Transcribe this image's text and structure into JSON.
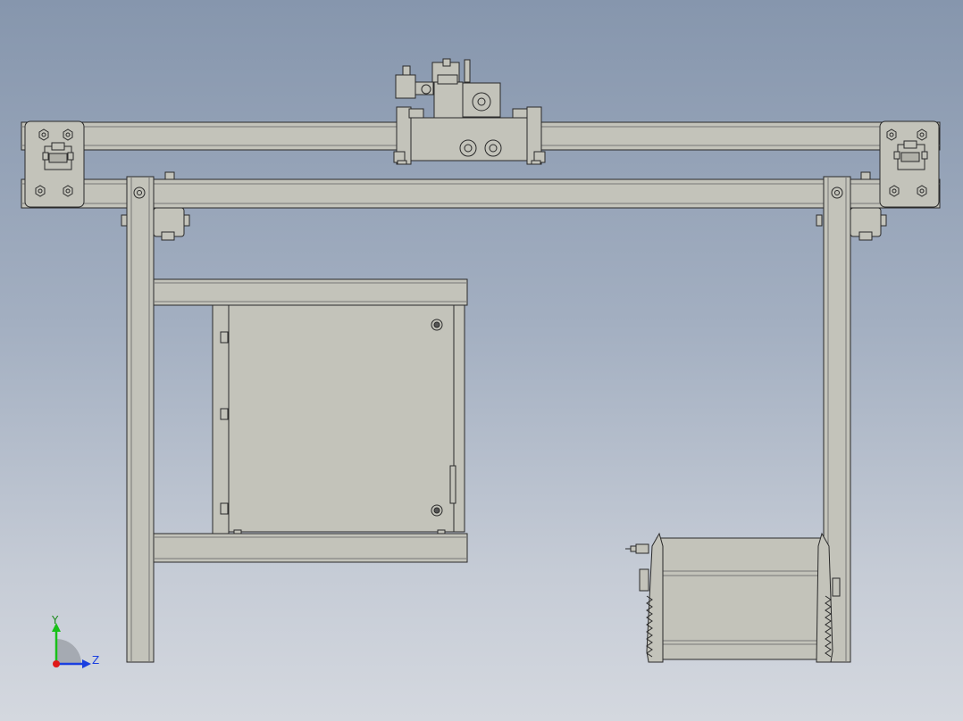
{
  "view": {
    "background_top": "#8696ad",
    "background_bottom": "#d4d8df",
    "part_fill": "#c3c3ba",
    "part_stroke": "#2a2a2a"
  },
  "triad": {
    "y_label": "Y",
    "z_label": "Z",
    "y_color": "#18c018",
    "z_color": "#1a3fe0",
    "x_color": "#e01818"
  }
}
